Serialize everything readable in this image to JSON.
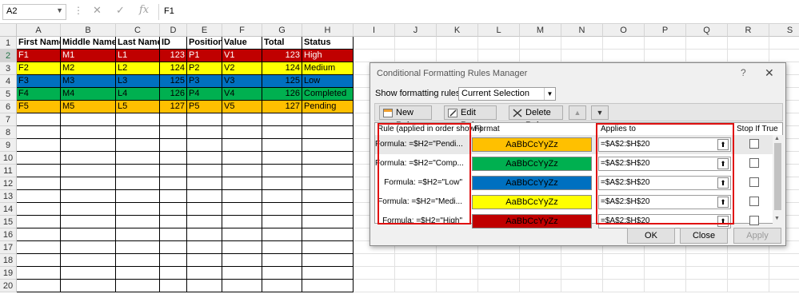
{
  "formula_bar": {
    "name_box": "A2",
    "fx": "fx",
    "formula": "F1"
  },
  "columns": [
    "A",
    "B",
    "C",
    "D",
    "E",
    "F",
    "G",
    "H",
    "I",
    "J",
    "K",
    "L",
    "M",
    "N",
    "O",
    "P",
    "Q",
    "R",
    "S"
  ],
  "rows": [
    "1",
    "2",
    "3",
    "4",
    "5",
    "6",
    "7",
    "8",
    "9",
    "10",
    "11",
    "12",
    "13",
    "14",
    "15",
    "16",
    "17",
    "18",
    "19",
    "20"
  ],
  "table": {
    "headers": [
      "First Name",
      "Middle Name",
      "Last Name",
      "ID",
      "Position",
      "Value",
      "Total",
      "Status"
    ],
    "data": [
      {
        "first": "F1",
        "middle": "M1",
        "last": "L1",
        "id": "123",
        "pos": "P1",
        "val": "V1",
        "total": "123",
        "status": "High",
        "color": "#c00000",
        "text": "#ffffff"
      },
      {
        "first": "F2",
        "middle": "M2",
        "last": "L2",
        "id": "124",
        "pos": "P2",
        "val": "V2",
        "total": "124",
        "status": "Medium",
        "color": "#ffff00",
        "text": "#000000"
      },
      {
        "first": "F3",
        "middle": "M3",
        "last": "L3",
        "id": "125",
        "pos": "P3",
        "val": "V3",
        "total": "125",
        "status": "Low",
        "color": "#0070c0",
        "text": "#000000"
      },
      {
        "first": "F4",
        "middle": "M4",
        "last": "L4",
        "id": "126",
        "pos": "P4",
        "val": "V4",
        "total": "126",
        "status": "Completed",
        "color": "#00b050",
        "text": "#000000"
      },
      {
        "first": "F5",
        "middle": "M5",
        "last": "L5",
        "id": "127",
        "pos": "P5",
        "val": "V5",
        "total": "127",
        "status": "Pending",
        "color": "#ffc000",
        "text": "#000000"
      }
    ]
  },
  "dialog": {
    "title": "Conditional Formatting Rules Manager",
    "help": "?",
    "close": "✕",
    "show_label": "Show formatting rules for:",
    "show_value": "Current Selection",
    "new_rule": "New Rule...",
    "edit_rule": "Edit Rule...",
    "delete_rule": "Delete Rule",
    "col_rule": "Rule (applied in order shown)",
    "col_format": "Format",
    "col_applies": "Applies to",
    "col_stop": "Stop If True",
    "rules": [
      {
        "cond": "Formula: =$H2=\"Pendi...",
        "preview": "AaBbCcYyZz",
        "bg": "#ffc000",
        "fg": "#000000",
        "applies": "=$A$2:$H$20"
      },
      {
        "cond": "Formula: =$H2=\"Comp...",
        "preview": "AaBbCcYyZz",
        "bg": "#00b050",
        "fg": "#000000",
        "applies": "=$A$2:$H$20"
      },
      {
        "cond": "Formula: =$H2=\"Low\"",
        "preview": "AaBbCcYyZz",
        "bg": "#0070c0",
        "fg": "#000000",
        "applies": "=$A$2:$H$20"
      },
      {
        "cond": "Formula: =$H2=\"Medi...",
        "preview": "AaBbCcYyZz",
        "bg": "#ffff00",
        "fg": "#000000",
        "applies": "=$A$2:$H$20"
      },
      {
        "cond": "Formula: =$H2=\"High\"",
        "preview": "AaBbCcYyZz",
        "bg": "#c00000",
        "fg": "#000000",
        "applies": "=$A$2:$H$20"
      }
    ],
    "ok": "OK",
    "close_btn": "Close",
    "apply": "Apply"
  },
  "colors": {
    "highlight_red": "#e01010",
    "header_bg": "#efefef"
  }
}
